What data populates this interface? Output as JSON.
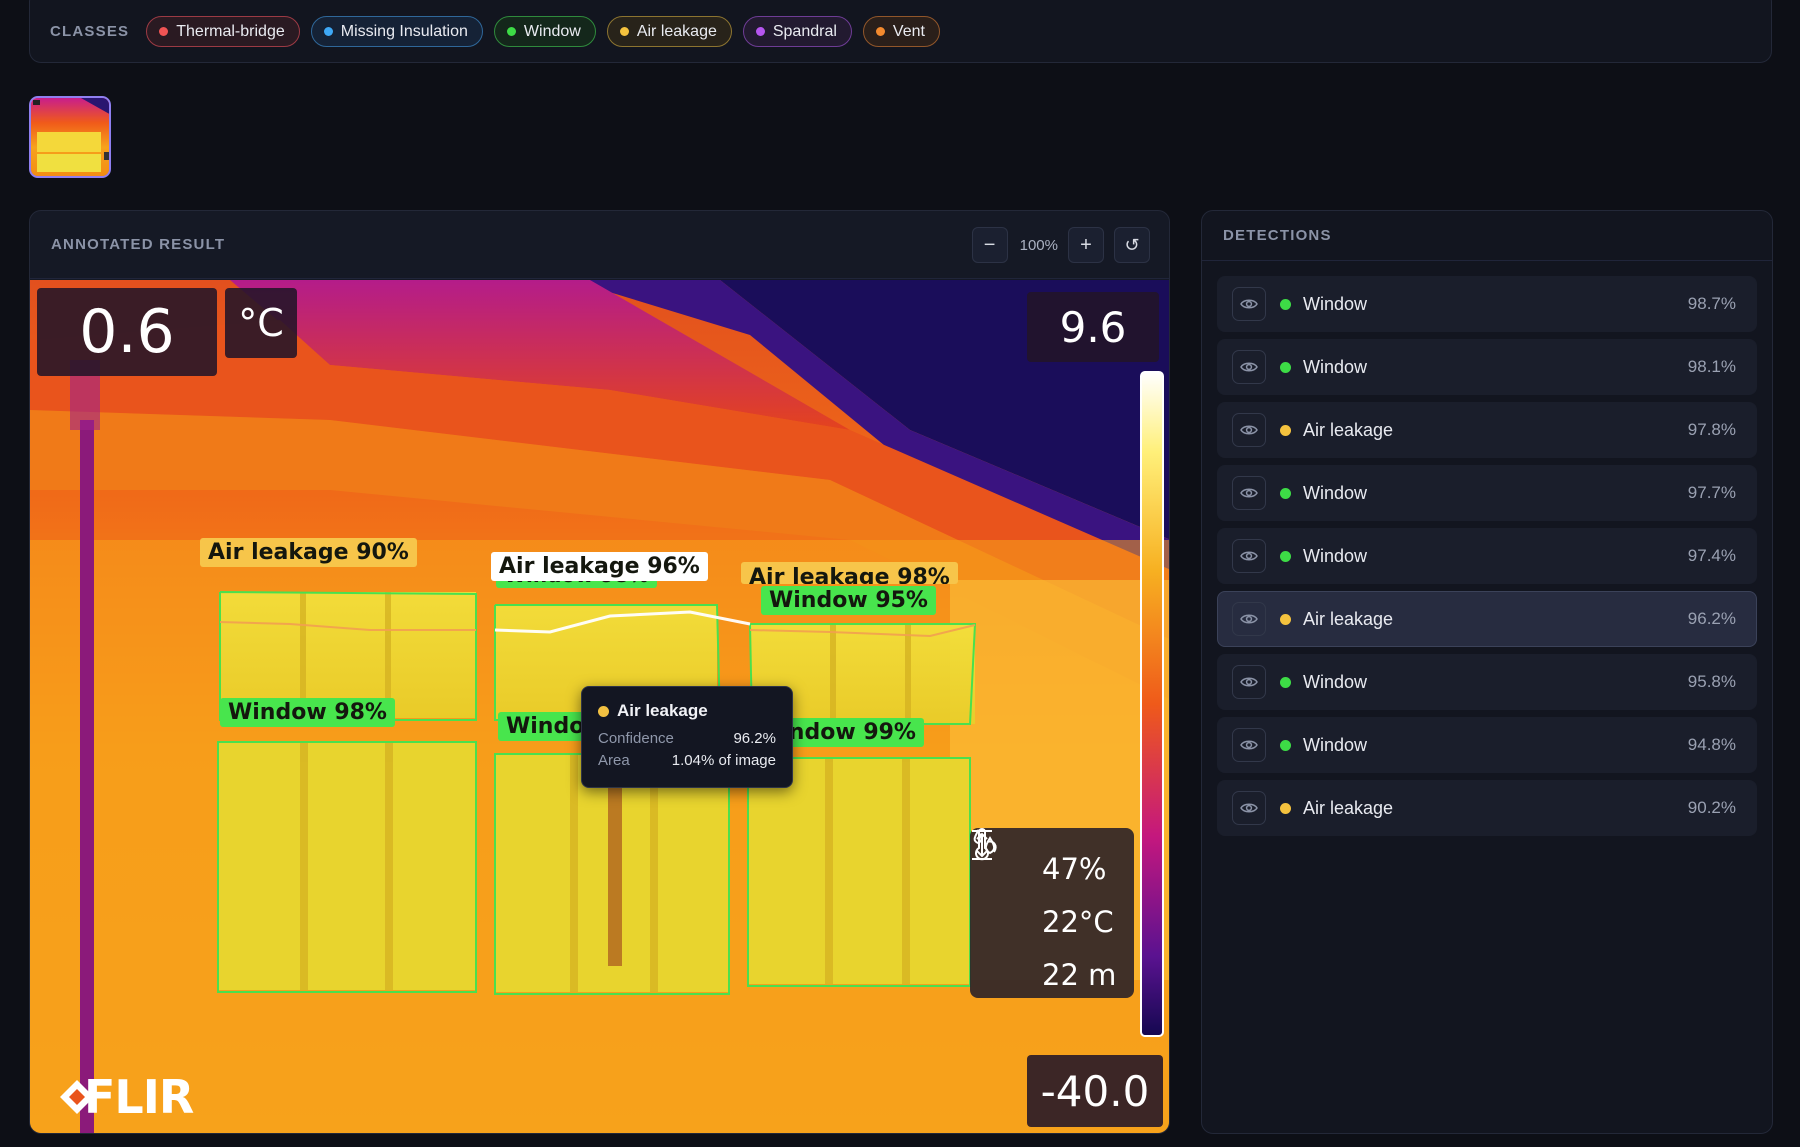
{
  "classes": {
    "title": "CLASSES",
    "items": [
      {
        "label": "Thermal-bridge",
        "dot": "#f05454",
        "border": "#9c3a44",
        "bg": "#2a1a22"
      },
      {
        "label": "Missing Insulation",
        "dot": "#3ea8f5",
        "border": "#2f6799",
        "bg": "#152236"
      },
      {
        "label": "Window",
        "dot": "#3ddc46",
        "border": "#2f8a3c",
        "bg": "#14271b"
      },
      {
        "label": "Air leakage",
        "dot": "#f4c23e",
        "border": "#8c7430",
        "bg": "#28231a"
      },
      {
        "label": "Spandral",
        "dot": "#b655f0",
        "border": "#6e3c95",
        "bg": "#221a30"
      },
      {
        "label": "Vent",
        "dot": "#f38a2e",
        "border": "#91562a",
        "bg": "#2a1f1a"
      }
    ]
  },
  "result": {
    "title": "ANNOTATED RESULT",
    "zoom_out": "−",
    "zoom_level": "100%",
    "zoom_in": "+",
    "reset": "↺"
  },
  "thermal": {
    "temp_value": "0.6",
    "temp_unit": "°C",
    "scale_max": "9.6",
    "scale_min": "-40.0",
    "brand": "FLIR",
    "humidity": "47%",
    "ambient": "22°C",
    "distance": "22 m",
    "labels": {
      "air1": "Air leakage  90%",
      "air2": "Air leakage  96%",
      "air3": "Air leakage  98%",
      "win_partial": "Window  98%",
      "win95": "Window  95%",
      "win98": "Window  98%",
      "win96": "Window  96%",
      "win99": "Window  99%"
    }
  },
  "tooltip": {
    "name": "Air leakage",
    "confidence_label": "Confidence",
    "confidence_value": "96.2%",
    "area_label": "Area",
    "area_value": "1.04% of image"
  },
  "detections": {
    "title": "DETECTIONS",
    "items": [
      {
        "name": "Window",
        "confidence": "98.7%",
        "color": "#3ddc46",
        "active": false
      },
      {
        "name": "Window",
        "confidence": "98.1%",
        "color": "#3ddc46",
        "active": false
      },
      {
        "name": "Air leakage",
        "confidence": "97.8%",
        "color": "#f4c23e",
        "active": false
      },
      {
        "name": "Window",
        "confidence": "97.7%",
        "color": "#3ddc46",
        "active": false
      },
      {
        "name": "Window",
        "confidence": "97.4%",
        "color": "#3ddc46",
        "active": false
      },
      {
        "name": "Air leakage",
        "confidence": "96.2%",
        "color": "#f4c23e",
        "active": true
      },
      {
        "name": "Window",
        "confidence": "95.8%",
        "color": "#3ddc46",
        "active": false
      },
      {
        "name": "Window",
        "confidence": "94.8%",
        "color": "#3ddc46",
        "active": false
      },
      {
        "name": "Air leakage",
        "confidence": "90.2%",
        "color": "#f4c23e",
        "active": false
      }
    ]
  }
}
